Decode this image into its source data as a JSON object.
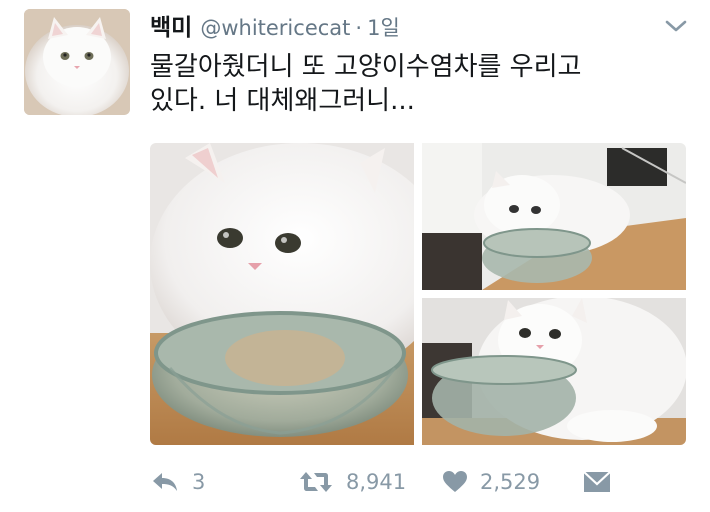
{
  "tweet": {
    "display_name": "백미",
    "handle": "@whitericecat",
    "separator": "·",
    "time": "1일",
    "text_lines": [
      "물갈아줬더니 또 고양이수염차를 우리고",
      "있다. 너 대체왜그러니..."
    ]
  },
  "icons": {
    "caret": "chevron-down-icon",
    "reply": "reply-icon",
    "retweet": "retweet-icon",
    "like": "heart-icon",
    "dm": "envelope-icon"
  },
  "actions": {
    "reply_count": "3",
    "retweet_count": "8,941",
    "like_count": "2,529"
  },
  "colors": {
    "text": "#14171a",
    "secondary": "#657786",
    "icon": "#8899a6"
  }
}
